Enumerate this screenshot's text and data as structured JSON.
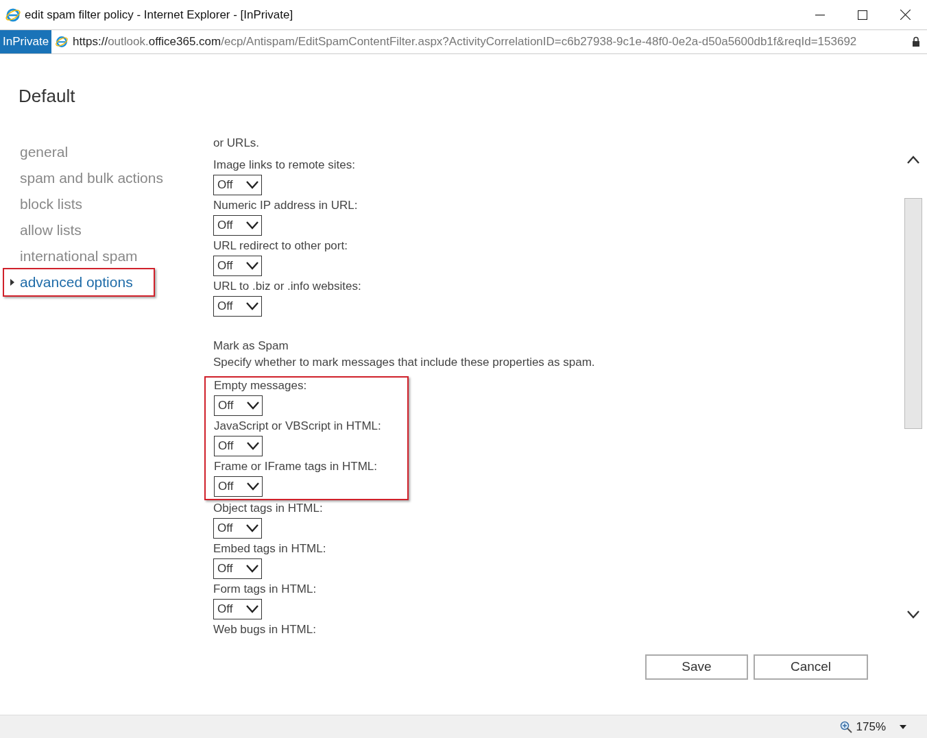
{
  "window": {
    "title": "edit spam filter policy - Internet Explorer - [InPrivate]"
  },
  "address_bar": {
    "badge": "InPrivate",
    "url_start": "https://",
    "url_sub": "outlook.",
    "url_domain": "office365.com",
    "url_path": "/ecp/Antispam/EditSpamContentFilter.aspx?ActivityCorrelationID=c6b27938-9c1e-48f0-0e2a-d50a5600db1f&reqId=153692"
  },
  "page_title": "Default",
  "nav": [
    {
      "label": "general",
      "selected": false,
      "highlighted": false
    },
    {
      "label": "spam and bulk actions",
      "selected": false,
      "highlighted": false
    },
    {
      "label": "block lists",
      "selected": false,
      "highlighted": false
    },
    {
      "label": "allow lists",
      "selected": false,
      "highlighted": false
    },
    {
      "label": "international spam",
      "selected": false,
      "highlighted": false
    },
    {
      "label": "advanced options",
      "selected": true,
      "highlighted": true
    }
  ],
  "sections": [
    {
      "description": "or URLs.",
      "settings": [
        {
          "label": "Image links to remote sites:",
          "value": "Off",
          "highlighted": false
        },
        {
          "label": "Numeric IP address in URL:",
          "value": "Off",
          "highlighted": false
        },
        {
          "label": "URL redirect to other port:",
          "value": "Off",
          "highlighted": false
        },
        {
          "label": "URL to .biz or .info websites:",
          "value": "Off",
          "highlighted": false
        }
      ]
    },
    {
      "heading": "Mark as Spam",
      "description": "Specify whether to mark messages that include these properties as spam.",
      "settings": [
        {
          "label": "Empty messages:",
          "value": "Off",
          "highlighted": true
        },
        {
          "label": "JavaScript or VBScript in HTML:",
          "value": "Off",
          "highlighted": true
        },
        {
          "label": "Frame or IFrame tags in HTML:",
          "value": "Off",
          "highlighted": true
        },
        {
          "label": "Object tags in HTML:",
          "value": "Off",
          "highlighted": false
        },
        {
          "label": "Embed tags in HTML:",
          "value": "Off",
          "highlighted": false
        },
        {
          "label": "Form tags in HTML:",
          "value": "Off",
          "highlighted": false
        },
        {
          "label": "Web bugs in HTML:",
          "highlighted": false
        }
      ]
    }
  ],
  "buttons": [
    "Save",
    "Cancel"
  ],
  "status_bar": {
    "zoom": "175%"
  }
}
